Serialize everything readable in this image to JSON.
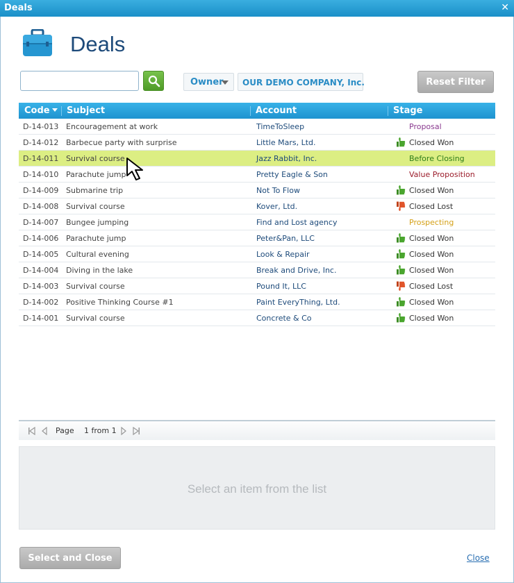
{
  "window": {
    "title": "Deals",
    "close_glyph": "✕"
  },
  "header": {
    "title": "Deals",
    "icon": "briefcase-icon"
  },
  "search": {
    "value": "",
    "placeholder": "",
    "button_icon": "search-icon"
  },
  "filters": {
    "owner_label": "Owner",
    "company_label": "OUR DEMO COMPANY, Inc.",
    "reset_label": "Reset Filter"
  },
  "grid": {
    "columns": [
      "Code",
      "Subject",
      "Account",
      "Stage"
    ],
    "sorted_column": "Code",
    "rows": [
      {
        "code": "D-14-013",
        "subject": "Encouragement at work",
        "account": "TimeToSleep",
        "stage": "Proposal",
        "icon": "",
        "stage_color": "#8a3a8f"
      },
      {
        "code": "D-14-012",
        "subject": "Barbecue party with surprise",
        "account": "Little Mars, Ltd.",
        "stage": "Closed Won",
        "icon": "thumbs-up-icon",
        "stage_color": "#333333"
      },
      {
        "code": "D-14-011",
        "subject": "Survival course",
        "account": "Jazz Rabbit, Inc.",
        "stage": "Before Closing",
        "icon": "",
        "stage_color": "#2e7d1a"
      },
      {
        "code": "D-14-010",
        "subject": "Parachute jump",
        "account": "Pretty Eagle & Son",
        "stage": "Value Proposition",
        "icon": "",
        "stage_color": "#9b1c2a"
      },
      {
        "code": "D-14-009",
        "subject": "Submarine trip",
        "account": "Not To Flow",
        "stage": "Closed Won",
        "icon": "thumbs-up-icon",
        "stage_color": "#333333"
      },
      {
        "code": "D-14-008",
        "subject": "Survival course",
        "account": "Kover, Ltd.",
        "stage": "Closed Lost",
        "icon": "thumbs-down-icon",
        "stage_color": "#333333"
      },
      {
        "code": "D-14-007",
        "subject": "Bungee jumping",
        "account": "Find and Lost agency",
        "stage": "Prospecting",
        "icon": "",
        "stage_color": "#d4a017"
      },
      {
        "code": "D-14-006",
        "subject": "Parachute jump",
        "account": "Peter&Pan, LLC",
        "stage": "Closed Won",
        "icon": "thumbs-up-icon",
        "stage_color": "#333333"
      },
      {
        "code": "D-14-005",
        "subject": "Cultural evening",
        "account": "Look & Repair",
        "stage": "Closed Won",
        "icon": "thumbs-up-icon",
        "stage_color": "#333333"
      },
      {
        "code": "D-14-004",
        "subject": "Diving in the lake",
        "account": "Break and Drive, Inc.",
        "stage": "Closed Won",
        "icon": "thumbs-up-icon",
        "stage_color": "#333333"
      },
      {
        "code": "D-14-003",
        "subject": "Survival course",
        "account": "Pound It, LLC",
        "stage": "Closed Lost",
        "icon": "thumbs-down-icon",
        "stage_color": "#333333"
      },
      {
        "code": "D-14-002",
        "subject": "Positive Thinking Course #1",
        "account": "Paint EveryThing, Ltd.",
        "stage": "Closed Won",
        "icon": "thumbs-up-icon",
        "stage_color": "#333333"
      },
      {
        "code": "D-14-001",
        "subject": "Survival course",
        "account": "Concrete & Co",
        "stage": "Closed Won",
        "icon": "thumbs-up-icon",
        "stage_color": "#333333"
      }
    ],
    "selected_index": 2
  },
  "pager": {
    "page_label": "Page",
    "page_info": "1 from 1"
  },
  "detail": {
    "empty_text": "Select an item from the list"
  },
  "footer": {
    "select_close_label": "Select and Close",
    "close_label": "Close"
  },
  "colors": {
    "accent": "#1e93cf",
    "selected_row": "#dcee83",
    "thumbs_up": "#4aa52e",
    "thumbs_down": "#e0552b"
  }
}
